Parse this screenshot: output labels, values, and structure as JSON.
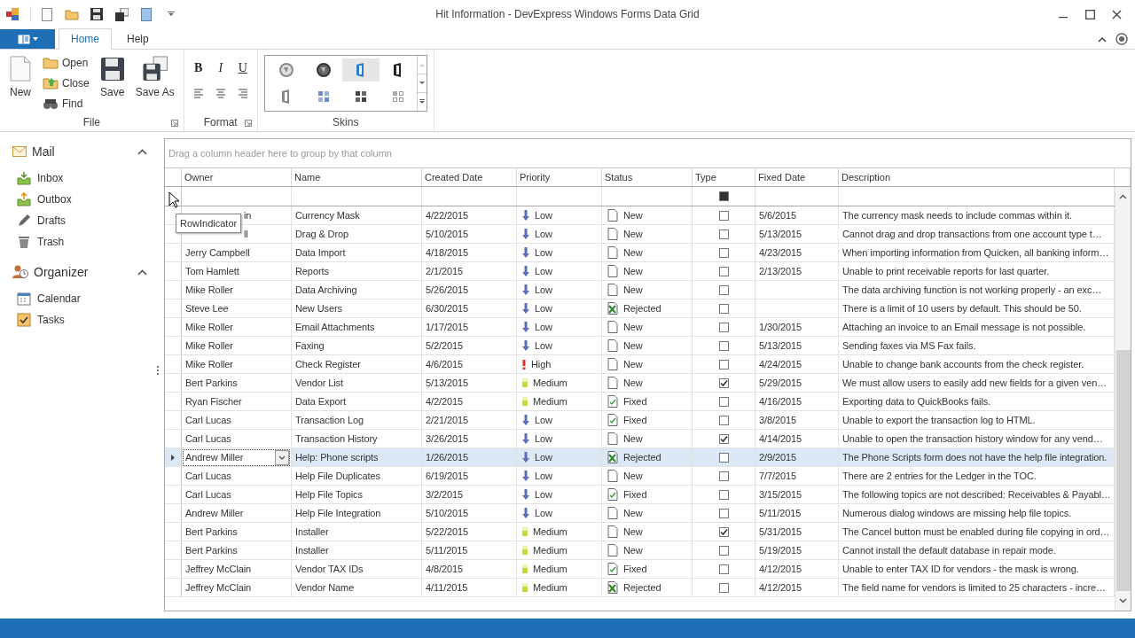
{
  "window": {
    "title": "Hit Information - DevExpress Windows Forms Data Grid"
  },
  "ribbon": {
    "tabs": [
      {
        "label": "Home",
        "selected": true
      },
      {
        "label": "Help",
        "selected": false
      }
    ],
    "groups": [
      {
        "kind": "file",
        "label": "File",
        "large": [
          {
            "label": "New",
            "kind": "new"
          }
        ],
        "small": [
          {
            "label": "Open",
            "kind": "open"
          },
          {
            "label": "Close",
            "kind": "close"
          },
          {
            "label": "Find",
            "kind": "find"
          }
        ],
        "large2": [
          {
            "label": "Save",
            "kind": "save"
          },
          {
            "label": "Save As",
            "kind": "saveas"
          }
        ]
      },
      {
        "kind": "format",
        "label": "Format",
        "buttons": [
          "B",
          "I",
          "U"
        ]
      },
      {
        "kind": "skins",
        "label": "Skins",
        "skins": [
          {
            "kind": "round-light",
            "selected": false
          },
          {
            "kind": "round-dark",
            "selected": false
          },
          {
            "kind": "office-blue",
            "selected": true
          },
          {
            "kind": "office-black",
            "selected": false
          },
          {
            "kind": "office-grey",
            "selected": false
          },
          {
            "kind": "tiles-blue",
            "selected": false
          },
          {
            "kind": "tiles-dark",
            "selected": false
          },
          {
            "kind": "tiles-light",
            "selected": false
          }
        ]
      }
    ]
  },
  "navigation": {
    "groups": [
      {
        "label": "Mail",
        "kind": "mail",
        "expanded": true,
        "items": [
          {
            "label": "Inbox",
            "kind": "inbox"
          },
          {
            "label": "Outbox",
            "kind": "outbox"
          },
          {
            "label": "Drafts",
            "kind": "drafts"
          },
          {
            "label": "Trash",
            "kind": "trash"
          }
        ]
      },
      {
        "label": "Organizer",
        "kind": "organizer",
        "expanded": true,
        "items": [
          {
            "label": "Calendar",
            "kind": "calendar"
          },
          {
            "label": "Tasks",
            "kind": "tasks"
          }
        ]
      }
    ]
  },
  "grid": {
    "group_panel_hint": "Drag a column header here to group by that column",
    "columns": [
      "Owner",
      "Name",
      "Created Date",
      "Priority",
      "Status",
      "Type",
      "Fixed Date",
      "Description"
    ],
    "filter_row": {
      "type_filter": {
        "kind": "indeterminate"
      }
    },
    "tooltip": "RowIndicator",
    "rows": [
      {
        "owner": "in",
        "owner_covered": true,
        "name": "Currency Mask",
        "created": "4/22/2015",
        "priority": {
          "label": "Low",
          "kind": "low"
        },
        "status": {
          "label": "New",
          "kind": "new"
        },
        "type_checked": false,
        "fixed": "5/6/2015",
        "description": "The currency mask needs to include commas within it.",
        "selected": false
      },
      {
        "owner": "ll",
        "owner_covered": true,
        "name": "Drag & Drop",
        "created": "5/10/2015",
        "priority": {
          "label": "Low",
          "kind": "low"
        },
        "status": {
          "label": "New",
          "kind": "new"
        },
        "type_checked": false,
        "fixed": "5/13/2015",
        "description": "Cannot drag and drop transactions from one account type t…",
        "selected": false
      },
      {
        "owner": "Jerry Campbell",
        "name": "Data Import",
        "created": "4/18/2015",
        "priority": {
          "label": "Low",
          "kind": "low"
        },
        "status": {
          "label": "New",
          "kind": "new"
        },
        "type_checked": false,
        "fixed": "4/23/2015",
        "description": "When importing information from Quicken, all banking inform…",
        "selected": false
      },
      {
        "owner": "Tom Hamlett",
        "name": "Reports",
        "created": "2/1/2015",
        "priority": {
          "label": "Low",
          "kind": "low"
        },
        "status": {
          "label": "New",
          "kind": "new"
        },
        "type_checked": false,
        "fixed": "2/13/2015",
        "description": "Unable to print receivable reports for last quarter.",
        "selected": false
      },
      {
        "owner": "Mike Roller",
        "name": "Data Archiving",
        "created": "5/26/2015",
        "priority": {
          "label": "Low",
          "kind": "low"
        },
        "status": {
          "label": "New",
          "kind": "new"
        },
        "type_checked": false,
        "description": "The data archiving function is not working properly - an exc…",
        "selected": false
      },
      {
        "owner": "Steve Lee",
        "name": "New Users",
        "created": "6/30/2015",
        "priority": {
          "label": "Low",
          "kind": "low"
        },
        "status": {
          "label": "Rejected",
          "kind": "rejected"
        },
        "type_checked": false,
        "description": "There is a limit of 10 users by default. This should be 50.",
        "selected": false
      },
      {
        "owner": "Mike Roller",
        "name": "Email Attachments",
        "created": "1/17/2015",
        "priority": {
          "label": "Low",
          "kind": "low"
        },
        "status": {
          "label": "New",
          "kind": "new"
        },
        "type_checked": false,
        "fixed": "1/30/2015",
        "description": "Attaching an invoice to an Email message is not possible.",
        "selected": false
      },
      {
        "owner": "Mike Roller",
        "name": "Faxing",
        "created": "5/2/2015",
        "priority": {
          "label": "Low",
          "kind": "low"
        },
        "status": {
          "label": "New",
          "kind": "new"
        },
        "type_checked": false,
        "fixed": "5/13/2015",
        "description": "Sending faxes via MS Fax fails.",
        "selected": false
      },
      {
        "owner": "Mike Roller",
        "name": "Check Register",
        "created": "4/6/2015",
        "priority": {
          "label": "High",
          "kind": "high"
        },
        "status": {
          "label": "New",
          "kind": "new"
        },
        "type_checked": false,
        "fixed": "4/24/2015",
        "description": "Unable to change bank accounts from the check register.",
        "selected": false
      },
      {
        "owner": "Bert Parkins",
        "name": "Vendor List",
        "created": "5/13/2015",
        "priority": {
          "label": "Medium",
          "kind": "medium"
        },
        "status": {
          "label": "New",
          "kind": "new"
        },
        "type_checked": true,
        "fixed": "5/29/2015",
        "description": "We must allow users to easily add new fields for a given ven…",
        "selected": false
      },
      {
        "owner": "Ryan Fischer",
        "name": "Data Export",
        "created": "4/2/2015",
        "priority": {
          "label": "Medium",
          "kind": "medium"
        },
        "status": {
          "label": "Fixed",
          "kind": "fixed"
        },
        "type_checked": false,
        "fixed": "4/16/2015",
        "description": "Exporting data to QuickBooks fails.",
        "selected": false
      },
      {
        "owner": "Carl Lucas",
        "name": "Transaction Log",
        "created": "2/21/2015",
        "priority": {
          "label": "Low",
          "kind": "low"
        },
        "status": {
          "label": "Fixed",
          "kind": "fixed"
        },
        "type_checked": false,
        "fixed": "3/8/2015",
        "description": "Unable to export the transaction log to HTML.",
        "selected": false
      },
      {
        "owner": "Carl Lucas",
        "name": "Transaction History",
        "created": "3/26/2015",
        "priority": {
          "label": "Low",
          "kind": "low"
        },
        "status": {
          "label": "New",
          "kind": "new"
        },
        "type_checked": true,
        "fixed": "4/14/2015",
        "description": "Unable to open the transaction history window for any vend…",
        "selected": false
      },
      {
        "owner": "Andrew Miller",
        "name": "Help: Phone scripts",
        "created": "1/26/2015",
        "priority": {
          "label": "Low",
          "kind": "low"
        },
        "status": {
          "label": "Rejected",
          "kind": "rejected"
        },
        "type_checked": false,
        "fixed": "2/9/2015",
        "description": "The Phone Scripts form does not have the help file integration.",
        "selected": true
      },
      {
        "owner": "Carl Lucas",
        "name": "Help File Duplicates",
        "created": "6/19/2015",
        "priority": {
          "label": "Low",
          "kind": "low"
        },
        "status": {
          "label": "New",
          "kind": "new"
        },
        "type_checked": false,
        "fixed": "7/7/2015",
        "description": "There are 2 entries for the Ledger in the TOC.",
        "selected": false
      },
      {
        "owner": "Carl Lucas",
        "name": "Help File Topics",
        "created": "3/2/2015",
        "priority": {
          "label": "Low",
          "kind": "low"
        },
        "status": {
          "label": "Fixed",
          "kind": "fixed"
        },
        "type_checked": false,
        "fixed": "3/15/2015",
        "description": "The following topics are not described: Receivables & Payabl…",
        "selected": false
      },
      {
        "owner": "Andrew Miller",
        "name": "Help File Integration",
        "created": "5/10/2015",
        "priority": {
          "label": "Low",
          "kind": "low"
        },
        "status": {
          "label": "New",
          "kind": "new"
        },
        "type_checked": false,
        "fixed": "5/11/2015",
        "description": "Numerous dialog windows are missing help file topics.",
        "selected": false
      },
      {
        "owner": "Bert Parkins",
        "name": "Installer",
        "created": "5/22/2015",
        "priority": {
          "label": "Medium",
          "kind": "medium"
        },
        "status": {
          "label": "New",
          "kind": "new"
        },
        "type_checked": true,
        "fixed": "5/31/2015",
        "description": "The Cancel button must be enabled during file copying in ord…",
        "selected": false
      },
      {
        "owner": "Bert Parkins",
        "name": "Installer",
        "created": "5/11/2015",
        "priority": {
          "label": "Medium",
          "kind": "medium"
        },
        "status": {
          "label": "New",
          "kind": "new"
        },
        "type_checked": false,
        "fixed": "5/19/2015",
        "description": "Cannot install the default database in repair mode.",
        "selected": false
      },
      {
        "owner": "Jeffrey McClain",
        "name": "Vendor TAX IDs",
        "created": "4/8/2015",
        "priority": {
          "label": "Medium",
          "kind": "medium"
        },
        "status": {
          "label": "Fixed",
          "kind": "fixed"
        },
        "type_checked": false,
        "fixed": "4/12/2015",
        "description": "Unable to enter TAX ID for vendors - the mask is wrong.",
        "selected": false
      },
      {
        "owner": "Jeffrey McClain",
        "name": "Vendor Name",
        "created": "4/11/2015",
        "priority": {
          "label": "Medium",
          "kind": "medium"
        },
        "status": {
          "label": "Rejected",
          "kind": "rejected"
        },
        "type_checked": false,
        "fixed": "4/12/2015",
        "description": "The field name for vendors is limited to 25 characters - incre…",
        "selected": false
      }
    ]
  }
}
